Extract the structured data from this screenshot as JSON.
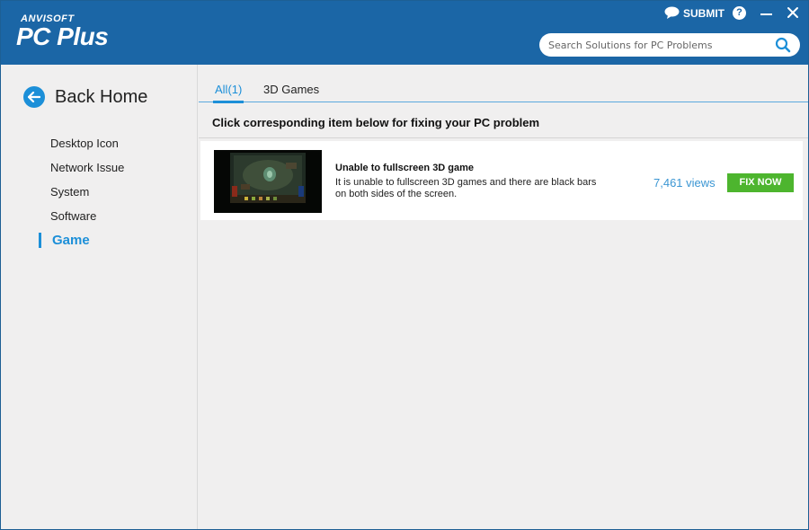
{
  "header": {
    "brand_small": "ANVISOFT",
    "brand_main": "PC Plus",
    "submit_label": "SUBMIT",
    "help_label": "?",
    "search_placeholder": "Search Solutions for PC Problems"
  },
  "sidebar": {
    "back_label": "Back Home",
    "items": [
      {
        "label": "Desktop Icon"
      },
      {
        "label": "Network Issue"
      },
      {
        "label": "System"
      },
      {
        "label": "Software"
      },
      {
        "label": "Game"
      }
    ],
    "active_item": "Game"
  },
  "main": {
    "tabs": [
      {
        "label": "All(1)"
      },
      {
        "label": "3D Games"
      }
    ],
    "active_tab": "All(1)",
    "section_title": "Click corresponding item below for fixing your PC problem",
    "items": [
      {
        "title": "Unable to fullscreen 3D game",
        "description": "It is unable to fullscreen 3D games and there are black bars on both sides of the screen.",
        "views": "7,461 views",
        "action_label": "FIX NOW"
      }
    ]
  },
  "colors": {
    "header_bg": "#1b66a6",
    "accent": "#1c8fd8",
    "fix_button": "#4db52e",
    "views_text": "#3b96d3"
  },
  "icons": [
    "chat-bubble-icon",
    "help-icon",
    "minimize-icon",
    "close-icon",
    "search-icon",
    "back-arrow-icon"
  ]
}
